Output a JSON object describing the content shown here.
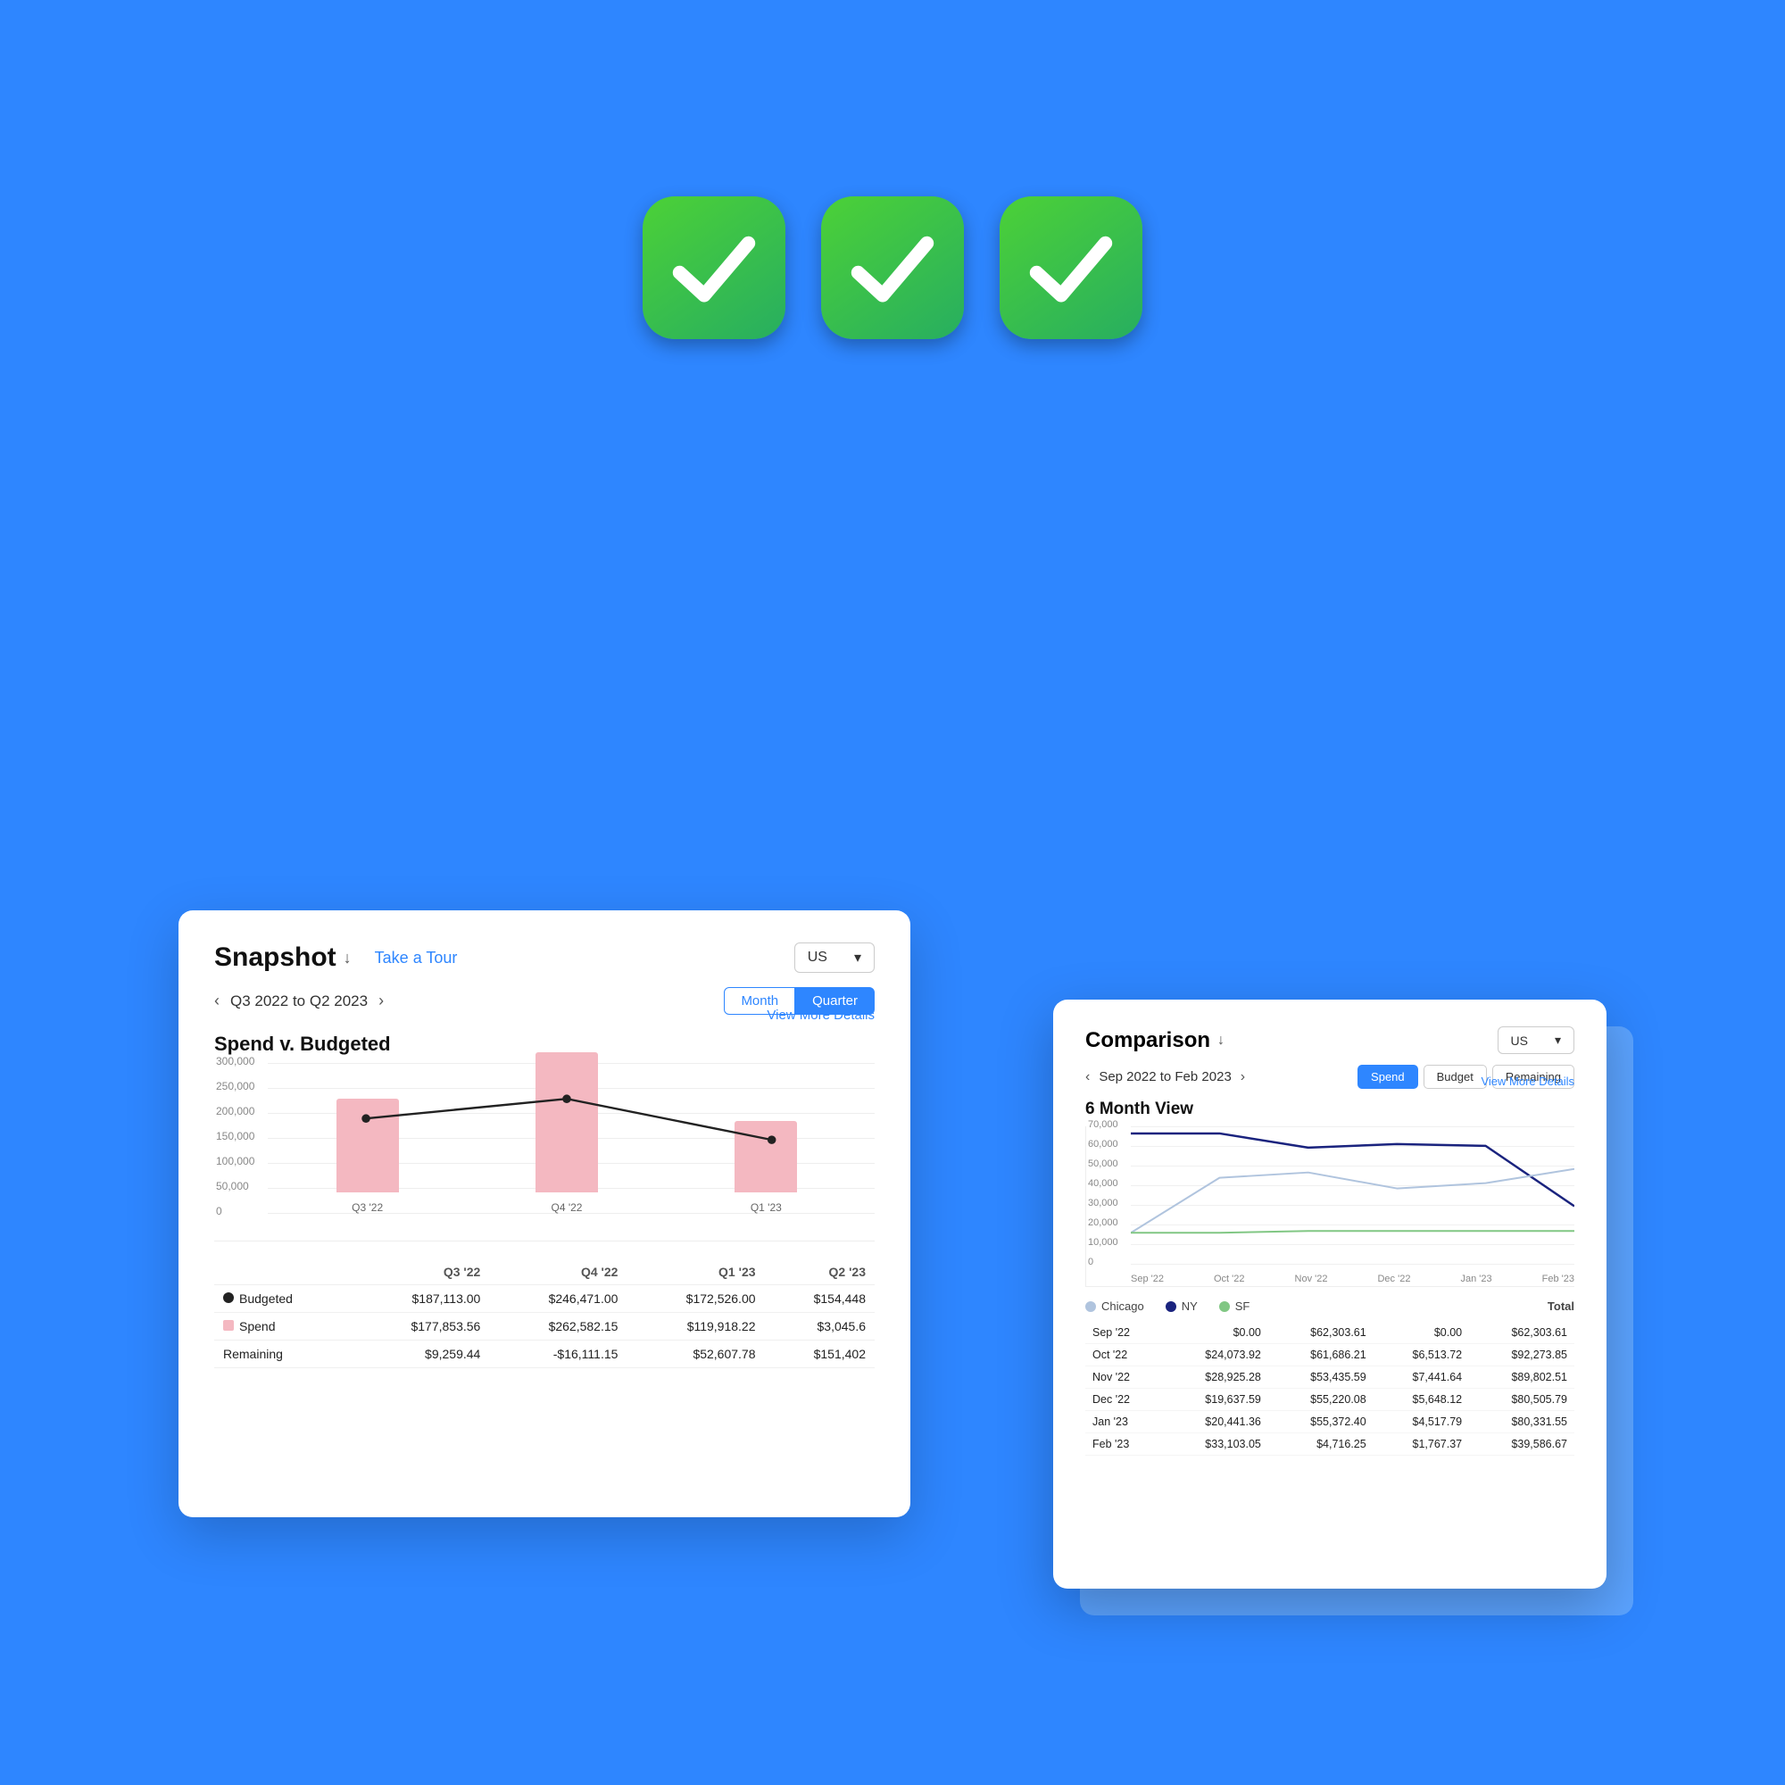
{
  "background": "#2E86FF",
  "checkmarks": {
    "count": 3,
    "icon": "✓"
  },
  "snapshot": {
    "title": "Snapshot",
    "take_tour": "Take a Tour",
    "dropdown_label": "US",
    "date_range": "Q3 2022  to  Q2 2023",
    "period_month": "Month",
    "period_quarter": "Quarter",
    "chart_title": "Spend v. Budgeted",
    "view_more": "View More Details",
    "y_labels": [
      "300,000",
      "250,000",
      "200,000",
      "150,000",
      "100,000",
      "50,000",
      "0"
    ],
    "x_labels": [
      "Q3 '22",
      "Q4 '22",
      "Q1 '23"
    ],
    "bars": [
      {
        "label": "Q3 '22",
        "height_pct": 60
      },
      {
        "label": "Q4 '22",
        "height_pct": 90
      },
      {
        "label": "Q1 '23",
        "height_pct": 45
      }
    ],
    "table_headers": [
      "",
      "Q3 '22",
      "Q4 '22",
      "Q1 '23",
      "Q2 '23"
    ],
    "table_rows": [
      {
        "label": "Budgeted",
        "type": "budgeted",
        "q3": "$187,113.00",
        "q4": "$246,471.00",
        "q1": "$172,526.00",
        "q2": "$154,448"
      },
      {
        "label": "Spend",
        "type": "spend",
        "q3": "$177,853.56",
        "q4": "$262,582.15",
        "q1": "$119,918.22",
        "q2": "$3,045.6"
      },
      {
        "label": "Remaining",
        "type": "remaining",
        "q3": "$9,259.44",
        "q4": "-$16,111.15",
        "q1": "$52,607.78",
        "q2": "$151,402"
      }
    ]
  },
  "comparison": {
    "title": "Comparison",
    "dropdown_label": "US",
    "date_range": "Sep 2022  to  Feb 2023",
    "buttons": [
      "Spend",
      "Budget",
      "Remaining"
    ],
    "active_button": "Spend",
    "chart_title": "6 Month View",
    "view_more": "View More Details",
    "y_labels": [
      "70,000",
      "60,000",
      "50,000",
      "40,000",
      "30,000",
      "20,000",
      "10,000",
      "0"
    ],
    "x_labels": [
      "Sep '22",
      "Oct '22",
      "Nov '22",
      "Dec '22",
      "Jan '23",
      "Feb '23"
    ],
    "legend": [
      {
        "label": "Chicago",
        "color": "#B0C4DE"
      },
      {
        "label": "NY",
        "color": "#1A237E"
      },
      {
        "label": "SF",
        "color": "#81C784"
      }
    ],
    "table_headers": [
      "",
      "Chicago",
      "NY",
      "SF",
      "Total"
    ],
    "table_rows": [
      {
        "period": "Sep '22",
        "chicago": "$0.00",
        "ny": "$62,303.61",
        "sf": "$0.00",
        "total": "$62,303.61"
      },
      {
        "period": "Oct '22",
        "chicago": "$24,073.92",
        "ny": "$61,686.21",
        "sf": "$6,513.72",
        "total": "$92,273.85"
      },
      {
        "period": "Nov '22",
        "chicago": "$28,925.28",
        "ny": "$53,435.59",
        "sf": "$7,441.64",
        "total": "$89,802.51"
      },
      {
        "period": "Dec '22",
        "chicago": "$19,637.59",
        "ny": "$55,220.08",
        "sf": "$5,648.12",
        "total": "$80,505.79"
      },
      {
        "period": "Jan '23",
        "chicago": "$20,441.36",
        "ny": "$55,372.40",
        "sf": "$4,517.79",
        "total": "$80,331.55"
      },
      {
        "period": "Feb '23",
        "chicago": "$33,103.05",
        "ny": "$4,716.25",
        "sf": "$1,767.37",
        "total": "$39,586.67"
      }
    ]
  }
}
